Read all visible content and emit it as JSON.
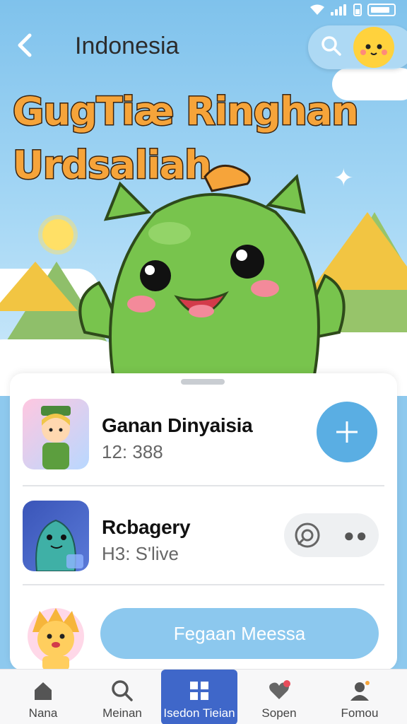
{
  "header": {
    "title": "Indonesia",
    "back_icon": "chevron-left-icon",
    "search_icon": "search-icon"
  },
  "hero": {
    "headline_line1": "GugTiæ Ringhan",
    "headline_line2": "Urdsaliah"
  },
  "list": {
    "items": [
      {
        "name": "Ganan Dinyaisia",
        "sub": "12: 388",
        "action_icon": "plus-icon"
      },
      {
        "name": "Rcbagery",
        "sub": "H3: S'live",
        "action_icon": "target-icon"
      }
    ],
    "cta_label": "Fegaan Meessa"
  },
  "bottom_nav": {
    "items": [
      {
        "label": "Nana",
        "icon": "home-icon"
      },
      {
        "label": "Meinan",
        "icon": "search-icon"
      },
      {
        "label": "Isedon Tieian",
        "icon": "grid-icon",
        "active": true
      },
      {
        "label": "Sopen",
        "icon": "heart-icon"
      },
      {
        "label": "Fomou",
        "icon": "profile-icon"
      }
    ]
  },
  "colors": {
    "accent": "#5aaee3",
    "nav_active": "#3f67c9",
    "headline": "#f6a43a",
    "mascot": "#78c44d"
  }
}
